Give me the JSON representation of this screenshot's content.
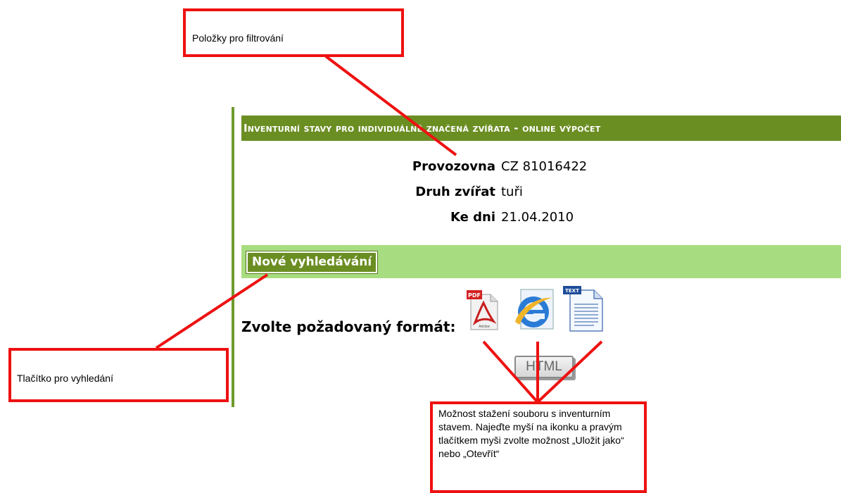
{
  "callouts": {
    "filter": "Položky pro filtrování",
    "search": "Tlačítko pro vyhledání",
    "download": "Možnost stažení souboru s inventurním stavem. Najeďte myší na ikonku a pravým tlačítkem myši zvolte možnost „Uložit jako“  nebo „Otevřít“"
  },
  "header": {
    "title": "Inventurní stavy pro individuálně značená zvířata - online výpočet"
  },
  "fields": [
    {
      "label": "Provozovna",
      "value": "CZ 81016422"
    },
    {
      "label": "Druh zvířat",
      "value": "tuři"
    },
    {
      "label": "Ke dni",
      "value": "21.04.2010"
    }
  ],
  "search": {
    "button_label": "Nové vyhledávání"
  },
  "export": {
    "label": "Zvolte požadovaný formát:",
    "formats": [
      "pdf-icon",
      "ie-icon",
      "text-file-icon"
    ],
    "html_button": "HTML"
  },
  "colors": {
    "title_bar": "#6b8e23",
    "search_bar": "#a8dc80",
    "callout_border": "#ee1111"
  }
}
